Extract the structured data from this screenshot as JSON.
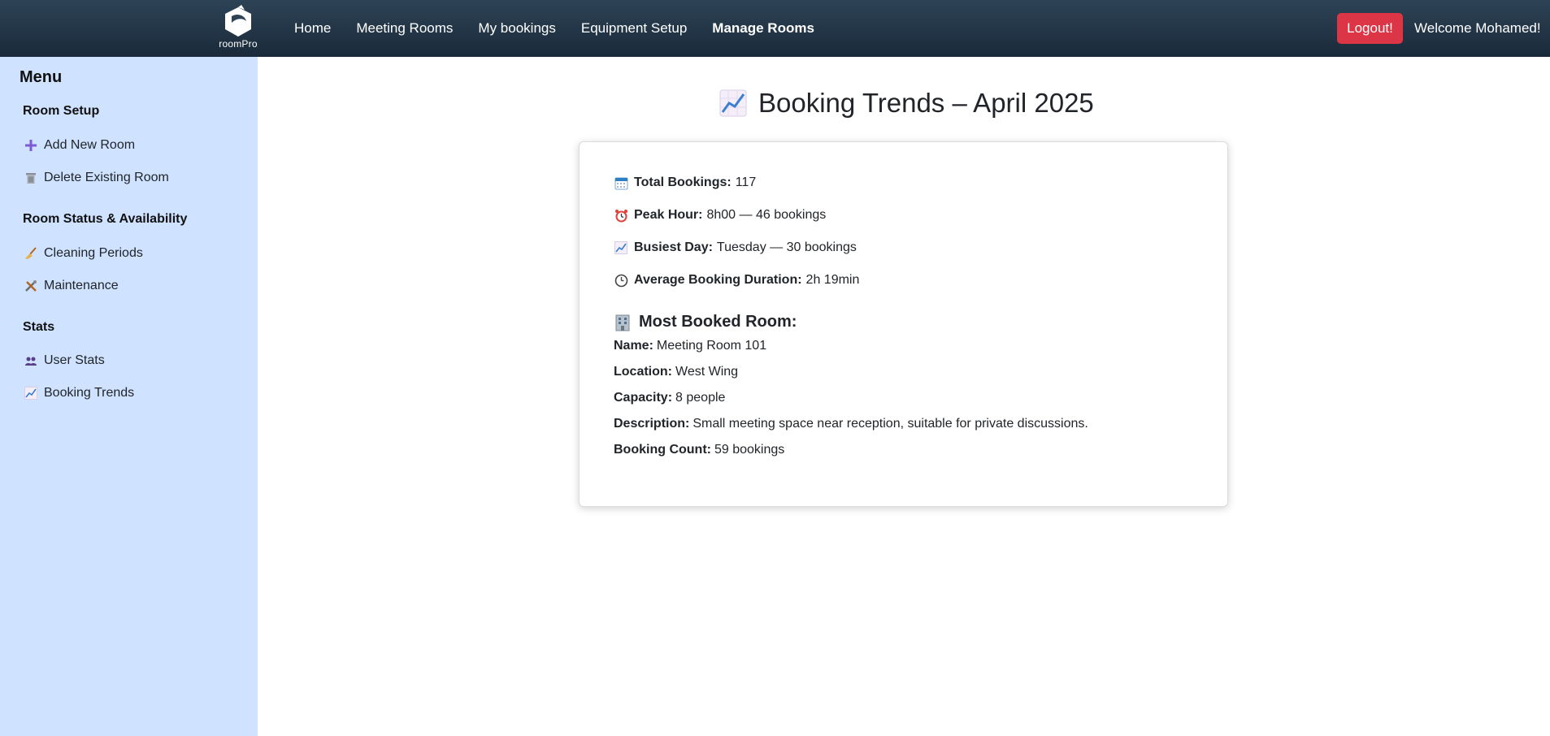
{
  "nav": {
    "brand": "roomPro",
    "links": [
      "Home",
      "Meeting Rooms",
      "My bookings",
      "Equipment Setup",
      "Manage Rooms"
    ],
    "logout": "Logout!",
    "welcome": "Welcome Mohamed!",
    "colors": {
      "bar_top": "#2d4356",
      "bar_bottom": "#1a2a3a",
      "logout": "#dc3545"
    }
  },
  "sidebar": {
    "title": "Menu",
    "background": "#cfe2ff",
    "sections": [
      {
        "title": "Room Setup",
        "items": [
          {
            "icon": "plus-icon",
            "label": "Add New Room"
          },
          {
            "icon": "trash-icon",
            "label": "Delete Existing Room"
          }
        ]
      },
      {
        "title": "Room Status & Availability",
        "items": [
          {
            "icon": "broom-icon",
            "label": "Cleaning Periods"
          },
          {
            "icon": "tools-icon",
            "label": "Maintenance"
          }
        ]
      },
      {
        "title": "Stats",
        "items": [
          {
            "icon": "users-icon",
            "label": "User Stats"
          },
          {
            "icon": "chart-up-icon",
            "label": "Booking Trends"
          }
        ]
      }
    ]
  },
  "main": {
    "title": "Booking Trends – April 2025",
    "stats": [
      {
        "icon": "calendar-icon",
        "label": "Total Bookings:",
        "value": "117"
      },
      {
        "icon": "alarm-clock-icon",
        "label": "Peak Hour:",
        "value": "8h00 — 46 bookings"
      },
      {
        "icon": "chart-up-icon",
        "label": "Busiest Day:",
        "value": "Tuesday — 30 bookings"
      },
      {
        "icon": "clock-icon",
        "label": "Average Booking Duration:",
        "value": "2h 19min"
      }
    ],
    "most_booked": {
      "title": "Most Booked Room:",
      "fields": [
        {
          "label": "Name:",
          "value": "Meeting Room 101"
        },
        {
          "label": "Location:",
          "value": "West Wing"
        },
        {
          "label": "Capacity:",
          "value": "8 people"
        },
        {
          "label": "Description:",
          "value": "Small meeting space near reception, suitable for private discussions."
        },
        {
          "label": "Booking Count:",
          "value": "59 bookings"
        }
      ]
    }
  }
}
